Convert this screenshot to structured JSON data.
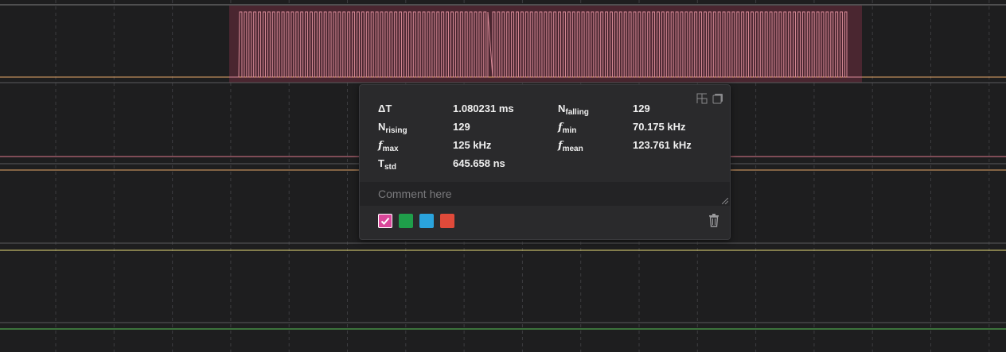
{
  "colors": {
    "background": "#1e1e1f",
    "selection_fill": "#4a2630",
    "waveform": "#d98b98",
    "trace_pink": "#e07a8c",
    "trace_orange": "#e8a86a",
    "trace_yellow": "#e8dc7a",
    "trace_green": "#5ac85a",
    "trace_gray": "#808080"
  },
  "popup": {
    "icons": [
      "expand-icon",
      "copy-icon"
    ],
    "measurements": [
      {
        "label": "ΔT",
        "sub": "",
        "italic": false,
        "value": "1.080231 ms"
      },
      {
        "label": "N",
        "sub": "falling",
        "italic": false,
        "value": "129"
      },
      {
        "label": "N",
        "sub": "rising",
        "italic": false,
        "value": "129"
      },
      {
        "label": "f",
        "sub": "min",
        "italic": true,
        "value": "70.175 kHz"
      },
      {
        "label": "f",
        "sub": "max",
        "italic": true,
        "value": "125 kHz"
      },
      {
        "label": "f",
        "sub": "mean",
        "italic": true,
        "value": "123.761 kHz"
      },
      {
        "label": "T",
        "sub": "std",
        "italic": false,
        "value": "645.658 ns"
      }
    ],
    "comment_placeholder": "Comment here",
    "swatches": [
      {
        "name": "pink",
        "color": "#d9479a",
        "selected": true
      },
      {
        "name": "green",
        "color": "#1f9e4a",
        "selected": false
      },
      {
        "name": "blue",
        "color": "#2aa3dc",
        "selected": false
      },
      {
        "name": "red",
        "color": "#e04a3a",
        "selected": false
      }
    ],
    "delete_icon": "trash-icon"
  }
}
